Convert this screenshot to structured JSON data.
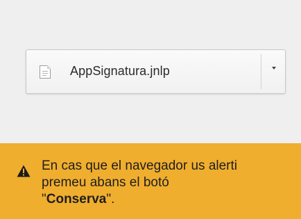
{
  "download": {
    "file_name": "AppSignatura.jnlp",
    "file_icon": "document-icon",
    "menu_icon": "chevron-down-icon"
  },
  "warning": {
    "icon": "warning-triangle-icon",
    "line1": "En cas que el navegador us alerti",
    "line2": "premeu abans el botó",
    "quote_open": "\"",
    "button_name": "Conserva",
    "quote_close": "\".",
    "background_color": "#f0ae2e"
  }
}
